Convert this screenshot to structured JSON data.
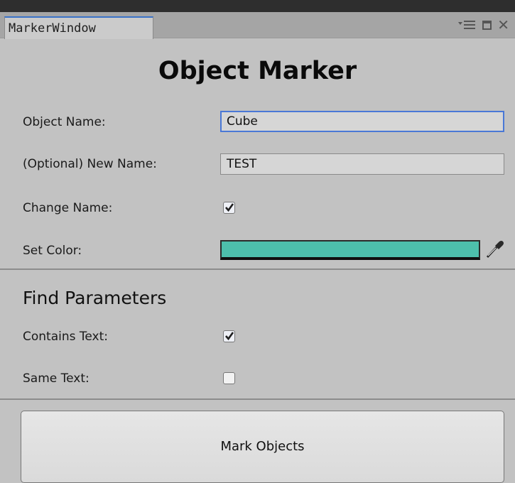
{
  "window": {
    "tab_title": "MarkerWindow",
    "controls": [
      "menu-icon",
      "maximize-icon",
      "close-icon"
    ]
  },
  "header": {
    "title": "Object Marker"
  },
  "form": {
    "object_name_label": "Object Name:",
    "object_name_value": "Cube",
    "new_name_label": "(Optional) New Name:",
    "new_name_value": "TEST",
    "change_name_label": "Change Name:",
    "change_name_checked": true,
    "set_color_label": "Set Color:",
    "set_color_value": "#4dbfac"
  },
  "find": {
    "title": "Find Parameters",
    "contains_text_label": "Contains Text:",
    "contains_text_checked": true,
    "same_text_label": "Same Text:",
    "same_text_checked": false
  },
  "actions": {
    "mark_label": "Mark Objects"
  },
  "colors": {
    "focus_border": "#4a78d6",
    "panel_bg": "#c2c2c2",
    "tab_accent": "#3a72c8"
  }
}
